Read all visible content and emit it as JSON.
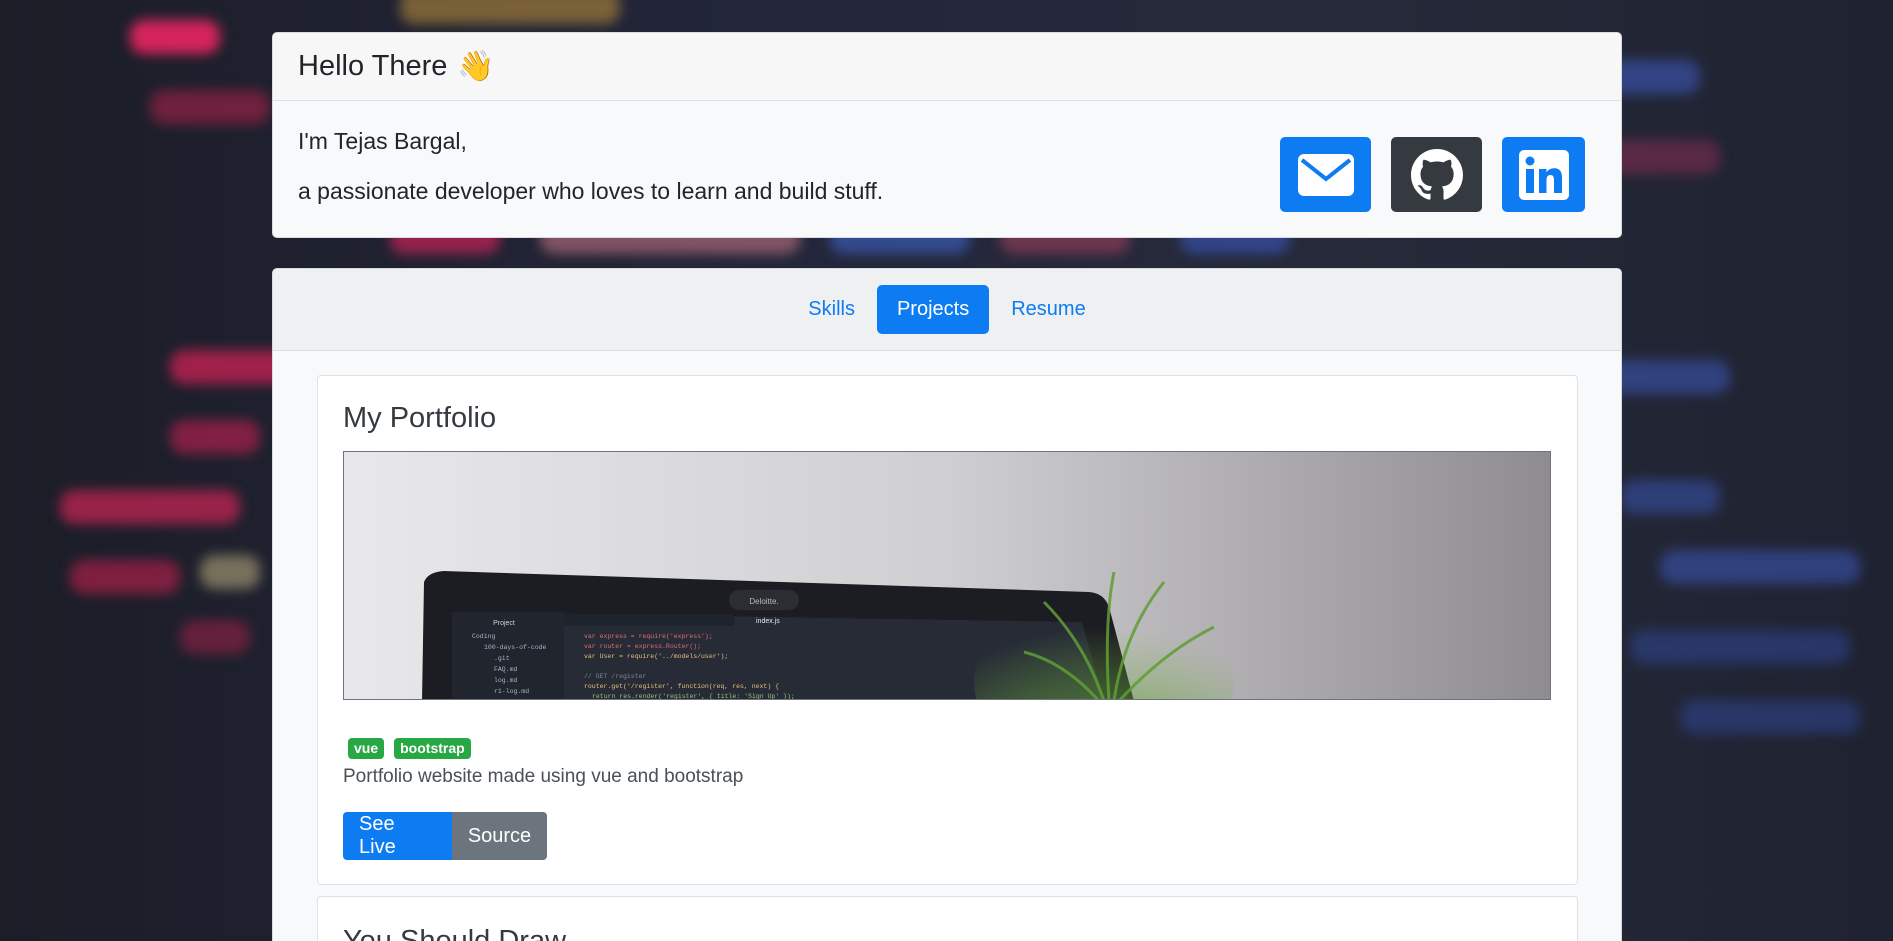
{
  "header": {
    "title": "Hello There",
    "wave_emoji": "👋",
    "intro_line1": "I'm Tejas Bargal,",
    "intro_line2": "a passionate developer who loves to learn and build stuff."
  },
  "social": [
    {
      "name": "email",
      "icon": "envelope-icon",
      "color": "#0d7cf2"
    },
    {
      "name": "github",
      "icon": "github-icon",
      "color": "#343a40"
    },
    {
      "name": "linkedin",
      "icon": "linkedin-icon",
      "color": "#0d7cf2"
    }
  ],
  "tabs": [
    {
      "label": "Skills",
      "active": false
    },
    {
      "label": "Projects",
      "active": true
    },
    {
      "label": "Resume",
      "active": false
    }
  ],
  "projects": [
    {
      "title": "My Portfolio",
      "tags": [
        "vue",
        "bootstrap"
      ],
      "description": "Portfolio website made using vue and bootstrap",
      "buttons": {
        "live": "See Live",
        "source": "Source"
      },
      "image": {
        "laptop_brand": "Deloitte.",
        "editor_tab": "index.js",
        "sidebar_header": "Project",
        "code_lines": [
          "var express = require('express');",
          "var router = express.Router();",
          "var User = require('../models/user');",
          "",
          "// GET /register",
          "router.get('/register', function(req, res, next) {",
          "  return res.render('register', { title: 'Sign Up' });",
          "});"
        ],
        "tree_items": [
          "Coding",
          "100-days-of-code",
          ".git",
          "FAQ.md",
          "log.md",
          "r1-log.md"
        ]
      }
    },
    {
      "title": "You Should Draw"
    }
  ],
  "colors": {
    "primary": "#0d7cf2",
    "dark": "#343a40",
    "secondary": "#6c757d",
    "success": "#28a745"
  }
}
